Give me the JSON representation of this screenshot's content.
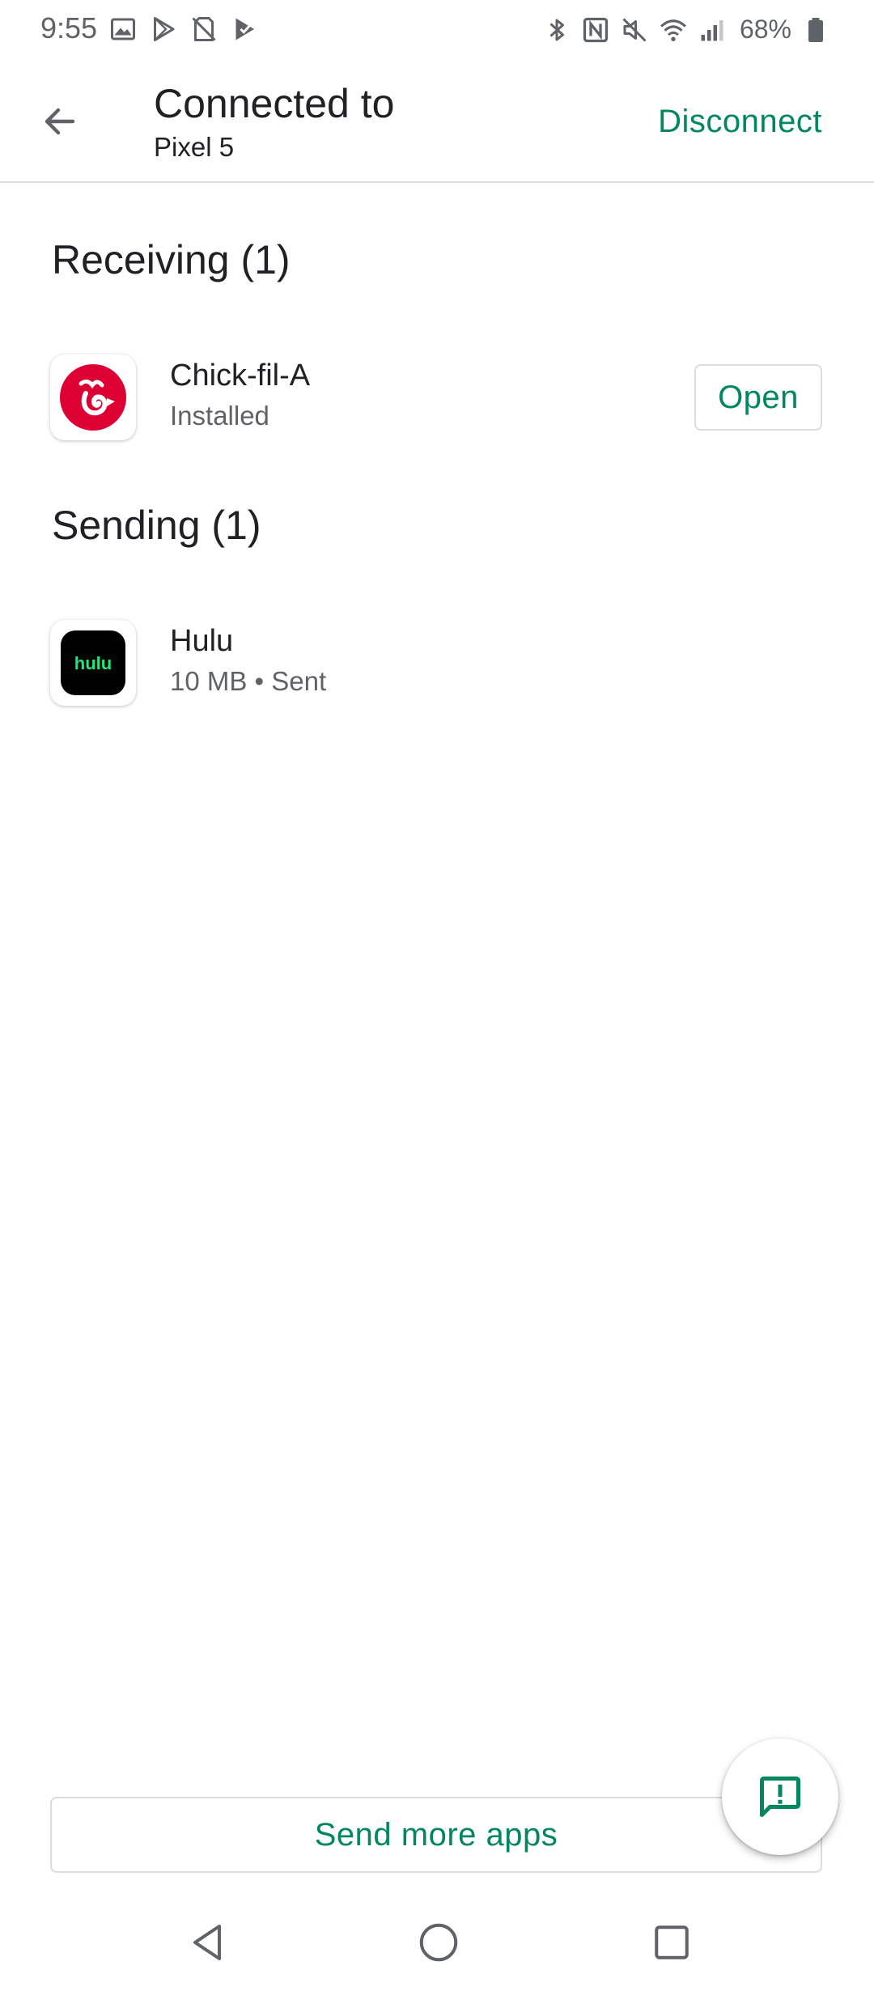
{
  "status_bar": {
    "time": "9:55",
    "battery_percent": "68%",
    "left_icons": [
      "gallery-icon",
      "play-store-icon",
      "sim-off-icon",
      "play-store-check-icon"
    ],
    "right_icons": [
      "bluetooth-icon",
      "nfc-icon",
      "mute-icon",
      "wifi-icon",
      "signal-icon",
      "battery-icon"
    ]
  },
  "app_bar": {
    "title": "Connected to",
    "subtitle": "Pixel 5",
    "disconnect_label": "Disconnect"
  },
  "receiving": {
    "heading": "Receiving (1)",
    "items": [
      {
        "name": "Chick-fil-A",
        "status": "Installed",
        "action_label": "Open",
        "icon": "chick-fil-a-icon"
      }
    ]
  },
  "sending": {
    "heading": "Sending (1)",
    "items": [
      {
        "name": "Hulu",
        "status": "10 MB • Sent",
        "icon": "hulu-icon",
        "icon_text": "hulu"
      }
    ]
  },
  "footer": {
    "send_more_label": "Send more apps"
  },
  "colors": {
    "accent": "#01875f",
    "text_primary": "#202124",
    "text_secondary": "#5f6368",
    "divider": "#dadce0",
    "chick_fil_a_red": "#dd0033",
    "hulu_green": "#1ce783"
  }
}
